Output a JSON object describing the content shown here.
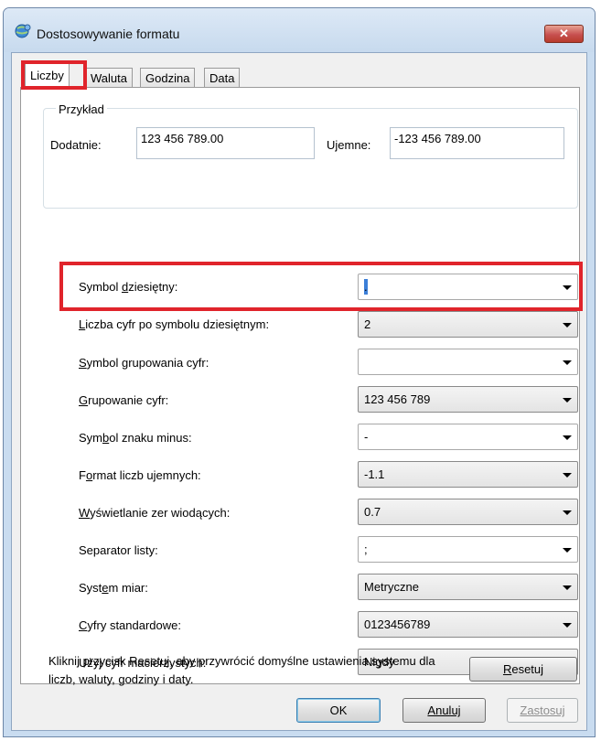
{
  "window": {
    "title": "Dostosowywanie formatu",
    "close_symbol": "✕"
  },
  "tabs": [
    {
      "label": "Liczby",
      "active": true
    },
    {
      "label": "Waluta",
      "active": false
    },
    {
      "label": "Godzina",
      "active": false
    },
    {
      "label": "Data",
      "active": false
    }
  ],
  "example": {
    "legend": "Przykład",
    "positive_label": "Dodatnie:",
    "positive_value": "123 456 789.00",
    "negative_label": "Ujemne:",
    "negative_value": "-123 456 789.00"
  },
  "settings": [
    {
      "label_pre": "Symbol ",
      "label_key": "d",
      "label_post": "ziesiętny:",
      "value": "."
    },
    {
      "label_pre": "",
      "label_key": "L",
      "label_post": "iczba cyfr po symbolu dziesiętnym:",
      "value": "2"
    },
    {
      "label_pre": "",
      "label_key": "S",
      "label_post": "ymbol grupowania cyfr:",
      "value": ""
    },
    {
      "label_pre": "",
      "label_key": "G",
      "label_post": "rupowanie cyfr:",
      "value": "123 456 789"
    },
    {
      "label_pre": "Sym",
      "label_key": "b",
      "label_post": "ol znaku minus:",
      "value": "-"
    },
    {
      "label_pre": "F",
      "label_key": "o",
      "label_post": "rmat liczb ujemnych:",
      "value": "-1.1"
    },
    {
      "label_pre": "",
      "label_key": "W",
      "label_post": "yświetlanie zer wiodących:",
      "value": "0.7"
    },
    {
      "label_pre": "Separator listy:",
      "label_key": "",
      "label_post": "",
      "value": ";"
    },
    {
      "label_pre": "Syst",
      "label_key": "e",
      "label_post": "m miar:",
      "value": "Metryczne"
    },
    {
      "label_pre": "",
      "label_key": "C",
      "label_post": "yfry standardowe:",
      "value": "0123456789"
    },
    {
      "label_pre": "Użyj cyfr macierzystych:",
      "label_key": "",
      "label_post": "",
      "value": "Nigdy"
    }
  ],
  "note": "Kliknij przycisk Resetuj, aby przywrócić domyślne ustawienia systemu dla liczb, waluty, godziny i daty.",
  "reset": {
    "pre": "",
    "key": "R",
    "post": "esetuj"
  },
  "buttons": {
    "ok": "OK",
    "cancel": "Anuluj",
    "apply": "Zastosuj"
  },
  "colors": {
    "highlight": "#e0242b",
    "caret": "#3c7fd8"
  }
}
